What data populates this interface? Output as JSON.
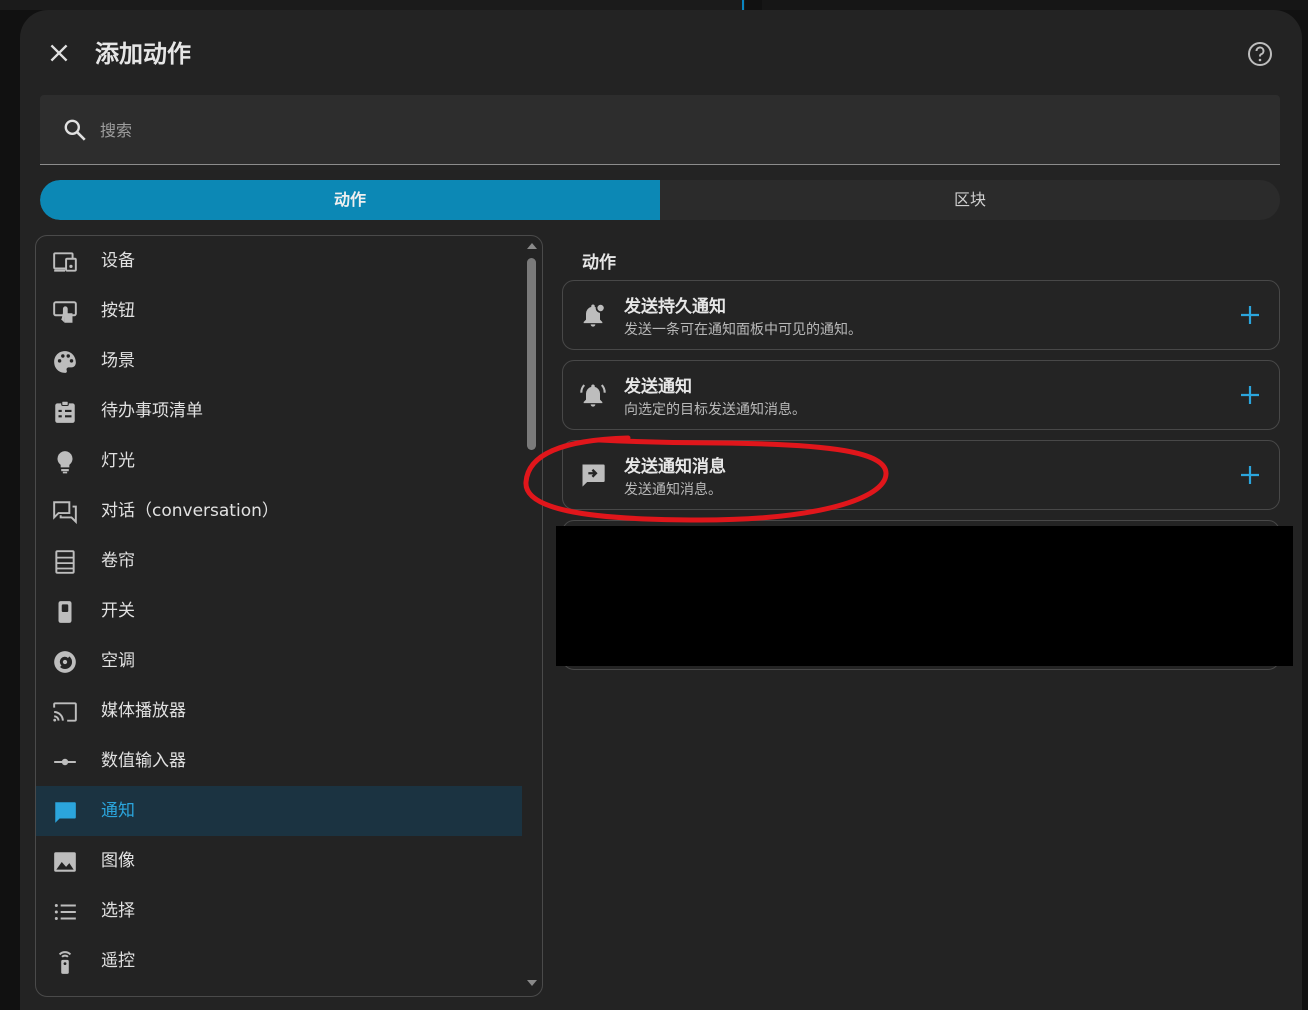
{
  "dialog": {
    "title": "添加动作",
    "close_icon": "close-icon",
    "help_icon": "help-circle-icon"
  },
  "search": {
    "placeholder": "搜索",
    "value": ""
  },
  "tabs": [
    {
      "label": "动作",
      "selected": true
    },
    {
      "label": "区块",
      "selected": false
    }
  ],
  "sidebar": {
    "items": [
      {
        "label": "设备",
        "icon": "devices-icon"
      },
      {
        "label": "按钮",
        "icon": "gesture-tap-button-icon"
      },
      {
        "label": "场景",
        "icon": "palette-icon"
      },
      {
        "label": "待办事项清单",
        "icon": "clipboard-list-icon"
      },
      {
        "label": "灯光",
        "icon": "lightbulb-icon"
      },
      {
        "label": "对话（conversation）",
        "icon": "forum-outline-icon"
      },
      {
        "label": "卷帘",
        "icon": "window-shutter-icon"
      },
      {
        "label": "开关",
        "icon": "toggle-switch-variant-icon"
      },
      {
        "label": "空调",
        "icon": "thermostat-icon"
      },
      {
        "label": "媒体播放器",
        "icon": "cast-icon"
      },
      {
        "label": "数值输入器",
        "icon": "ray-vertex-icon"
      },
      {
        "label": "通知",
        "icon": "message-icon",
        "active": true
      },
      {
        "label": "图像",
        "icon": "image-icon"
      },
      {
        "label": "选择",
        "icon": "format-list-bulleted-icon"
      },
      {
        "label": "遥控",
        "icon": "remote-icon"
      }
    ]
  },
  "main": {
    "section_title": "动作",
    "cards": [
      {
        "title": "发送持久通知",
        "description": "发送一条可在通知面板中可见的通知。",
        "icon": "bell-badge-icon",
        "add_icon": "plus-icon"
      },
      {
        "title": "发送通知",
        "description": "向选定的目标发送通知消息。",
        "icon": "bell-ring-icon",
        "add_icon": "plus-icon"
      },
      {
        "title": "发送通知消息",
        "description": "发送通知消息。",
        "icon": "message-arrow-right-icon",
        "add_icon": "plus-icon"
      }
    ]
  },
  "colors": {
    "accent": "#0c88b5",
    "active_text": "#2ba5dc",
    "annotation": "#e0161b"
  }
}
